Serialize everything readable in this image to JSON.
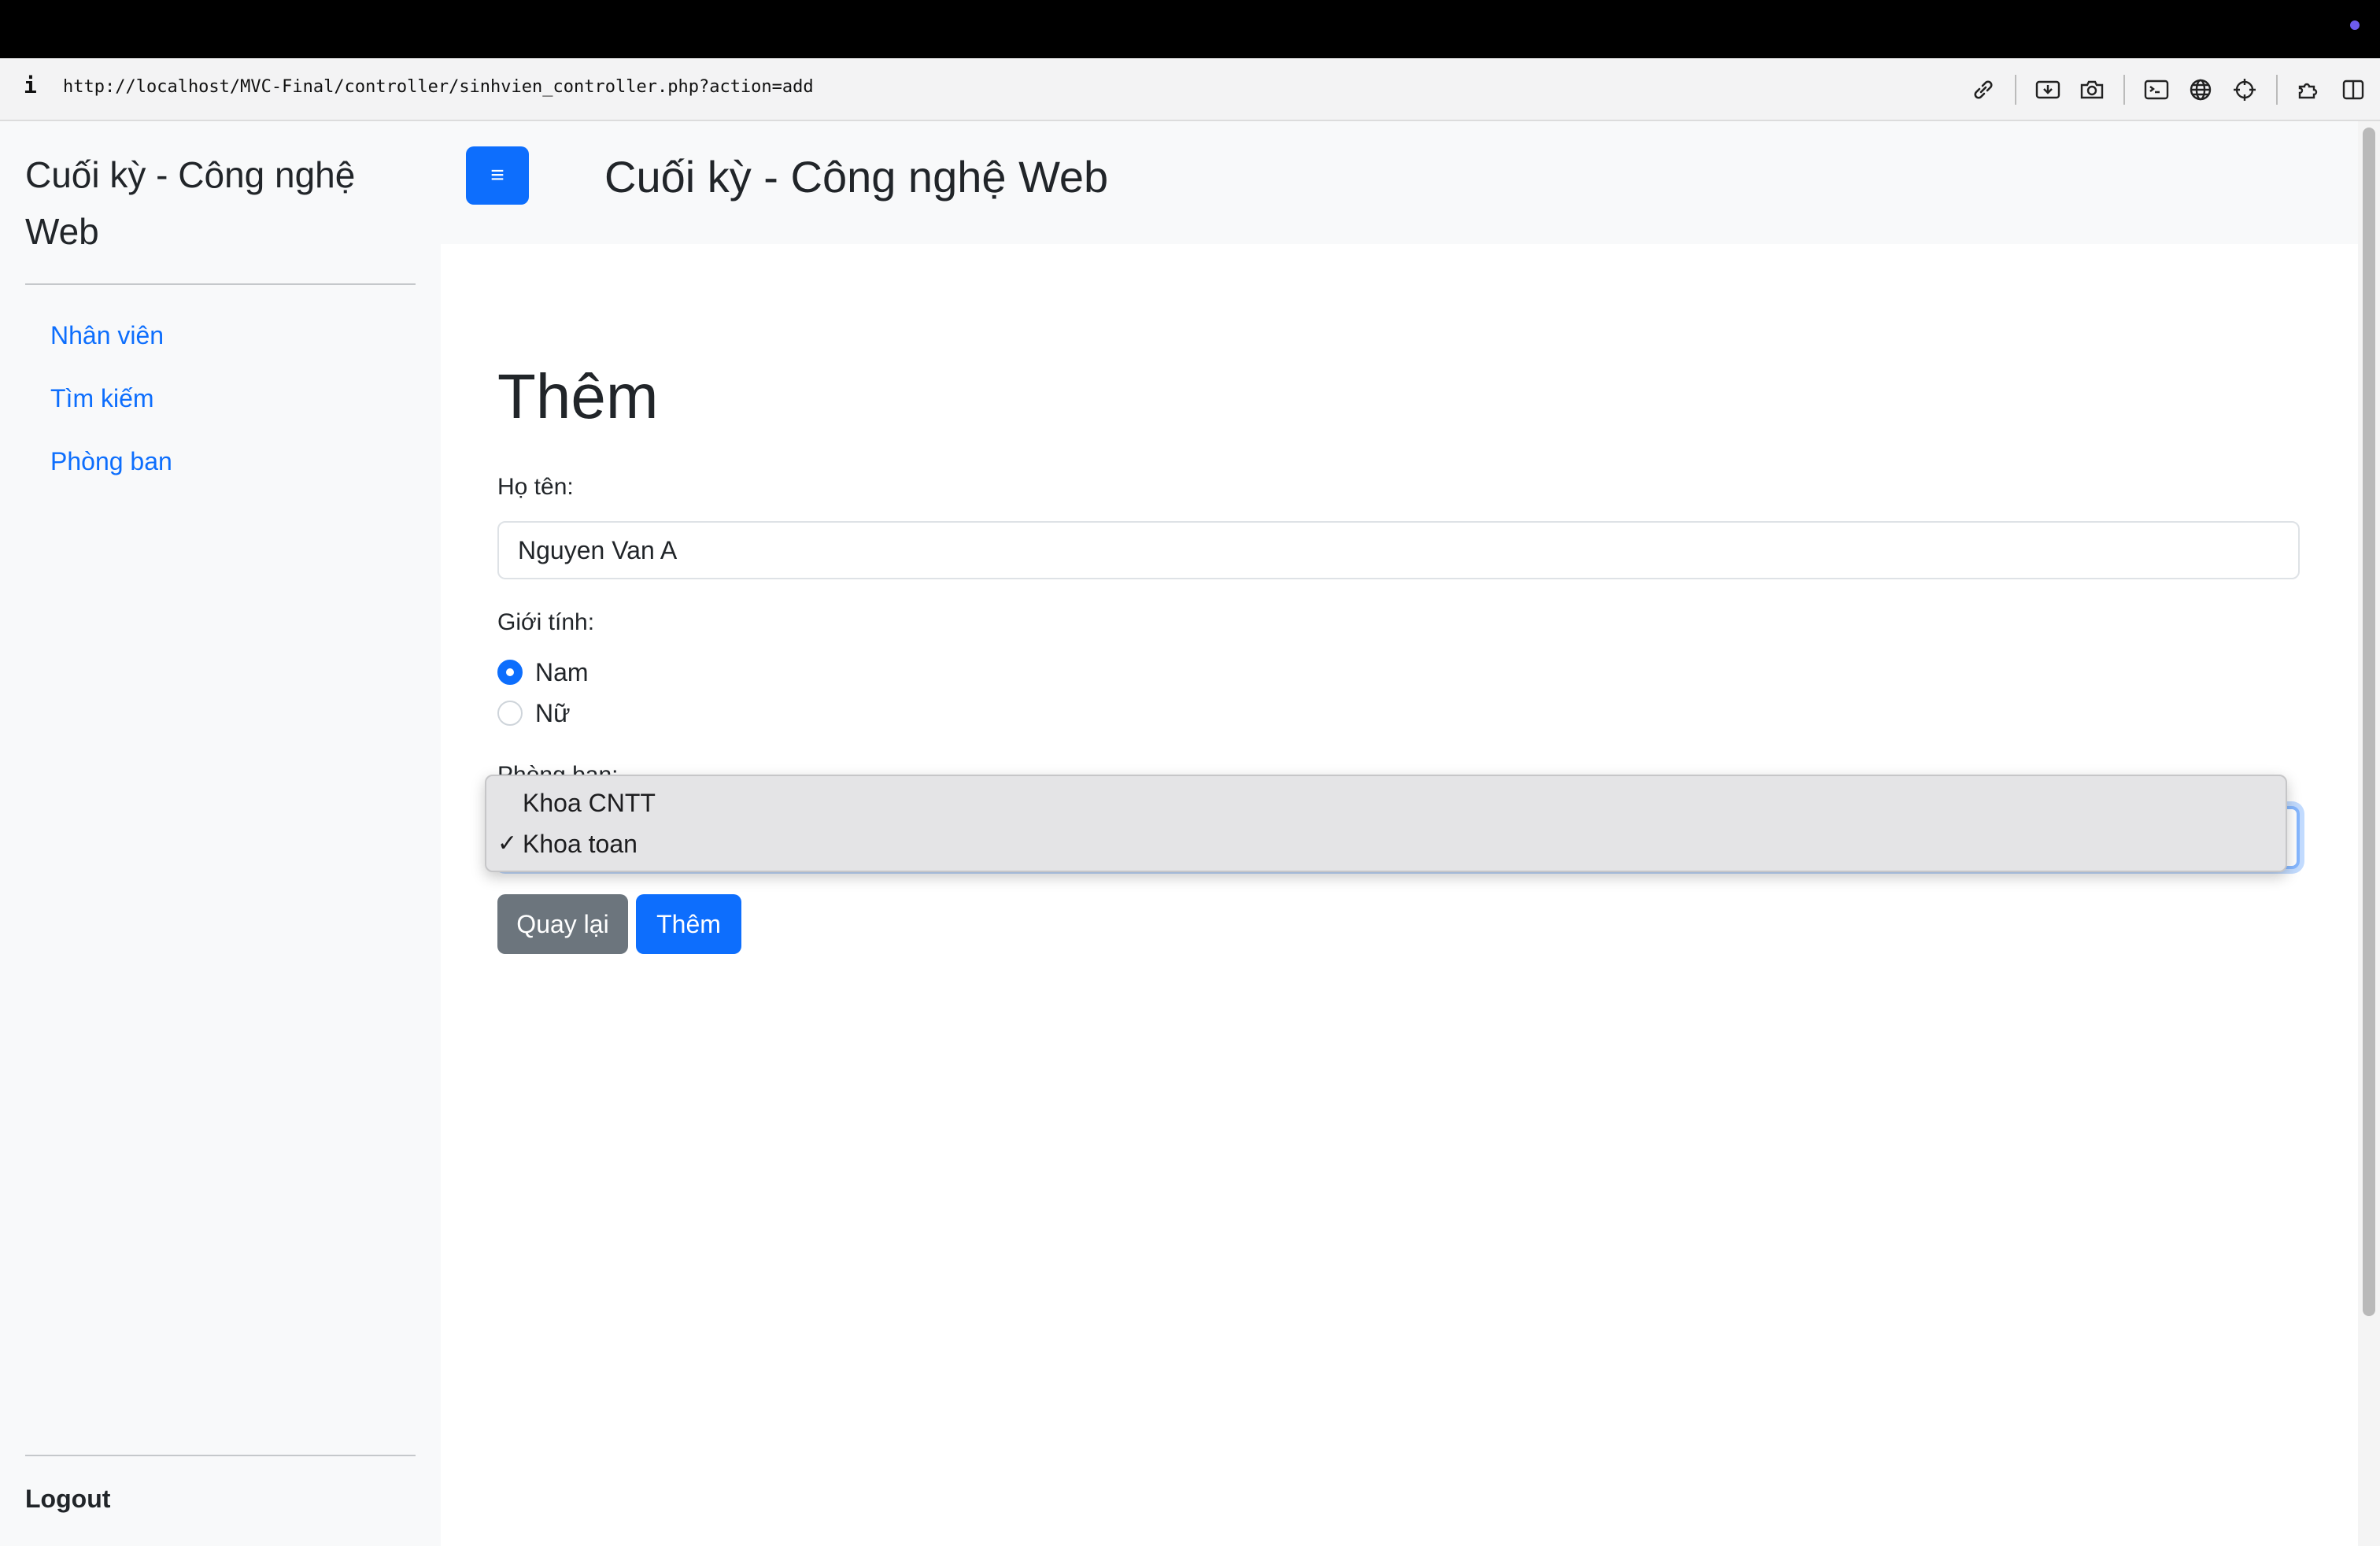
{
  "browser": {
    "url": "http://localhost/MVC-Final/controller/sinhvien_controller.php?action=add",
    "info_glyph": "i",
    "toolbar_icons": [
      "link-icon",
      "download-icon",
      "camera-icon",
      "terminal-icon",
      "globe-icon",
      "crosshair-icon",
      "extensions-icon",
      "sidebar-icon"
    ]
  },
  "sidebar": {
    "brand": "Cuối kỳ - Công nghệ Web",
    "items": [
      {
        "label": "Nhân viên"
      },
      {
        "label": "Tìm kiếm"
      },
      {
        "label": "Phòng ban"
      }
    ],
    "logout": "Logout"
  },
  "header": {
    "toggle_glyph": "≡",
    "title": "Cuối kỳ - Công nghệ Web"
  },
  "form": {
    "title": "Thêm",
    "name_label": "Họ tên:",
    "name_value": "Nguyen Van A",
    "gender_label": "Giới tính:",
    "gender_options": [
      {
        "label": "Nam",
        "checked": true
      },
      {
        "label": "Nữ",
        "checked": false
      }
    ],
    "department_label": "Phòng ban:",
    "department_options": [
      "Khoa CNTT",
      "Khoa toan"
    ],
    "department_selected": "Khoa toan",
    "back_button": "Quay lại",
    "submit_button": "Thêm"
  },
  "colors": {
    "primary": "#0d6efd",
    "secondary": "#6c757d",
    "sidebar_bg": "#f8f9fa"
  }
}
